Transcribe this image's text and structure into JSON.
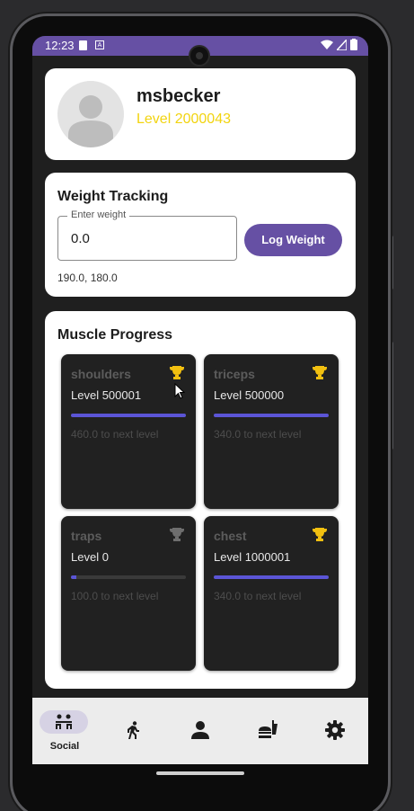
{
  "status": {
    "time": "12:23"
  },
  "profile": {
    "username": "msbecker",
    "level": "Level 2000043"
  },
  "weight": {
    "title": "Weight Tracking",
    "input_label": "Enter weight",
    "input_value": "0.0",
    "button": "Log Weight",
    "history": "190.0, 180.0"
  },
  "muscle": {
    "title": "Muscle Progress",
    "items": [
      {
        "name": "shoulders",
        "level": "Level 500001",
        "progress": 1.0,
        "next": "460.0 to next level",
        "trophy": "gold"
      },
      {
        "name": "triceps",
        "level": "Level 500000",
        "progress": 1.0,
        "next": "340.0 to next level",
        "trophy": "gold"
      },
      {
        "name": "traps",
        "level": "Level 0",
        "progress": 0.05,
        "next": "100.0 to next level",
        "trophy": "gray"
      },
      {
        "name": "chest",
        "level": "Level 1000001",
        "progress": 1.0,
        "next": "340.0 to next level",
        "trophy": "gold"
      }
    ]
  },
  "colors": {
    "accent": "#6650a4",
    "gold": "#f2c010",
    "gray": "#6e6e6e",
    "bar": "#5b55d6"
  },
  "nav": {
    "items": [
      {
        "label": "Social",
        "icon": "social-icon",
        "active": true
      },
      {
        "label": "",
        "icon": "run-icon"
      },
      {
        "label": "",
        "icon": "person-icon"
      },
      {
        "label": "",
        "icon": "food-icon"
      },
      {
        "label": "",
        "icon": "gear-icon"
      }
    ]
  }
}
